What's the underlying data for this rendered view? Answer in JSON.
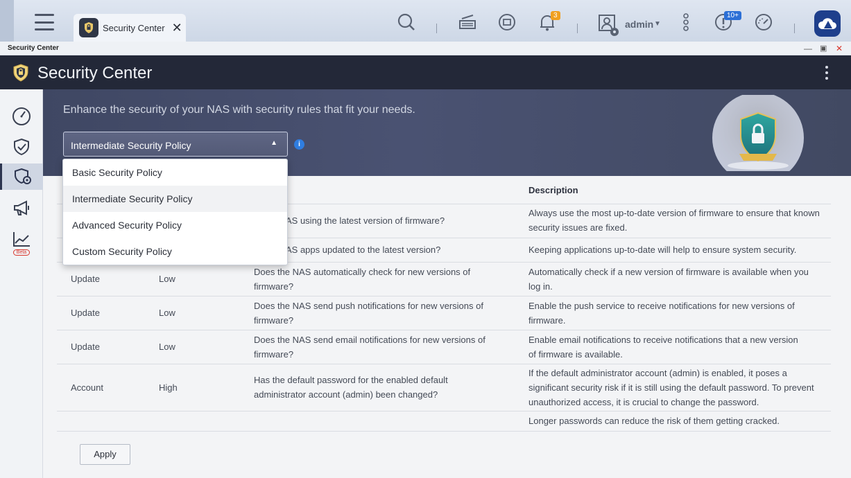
{
  "taskbar": {
    "tab_label": "Security Center",
    "notification_count": "3",
    "user_name": "admin",
    "update_badge": "10+"
  },
  "window": {
    "title": "Security Center"
  },
  "app": {
    "title": "Security Center"
  },
  "banner": {
    "subtitle": "Enhance the security of your NAS with security rules that fit your needs.",
    "info_icon": "i"
  },
  "policy_select": {
    "selected": "Intermediate Security Policy",
    "options": [
      "Basic Security Policy",
      "Intermediate Security Policy",
      "Advanced Security Policy",
      "Custom Security Policy"
    ]
  },
  "table": {
    "description_header": "Description",
    "rows": [
      {
        "category": "",
        "severity": "",
        "check": "AS using the latest version of firmware?",
        "description": "Always use the most up-to-date version of firmware to ensure that known security issues are fixed."
      },
      {
        "category": "",
        "severity": "",
        "check": "AS apps updated to the latest version?",
        "description": "Keeping applications up-to-date will help to ensure system security."
      },
      {
        "category": "Update",
        "severity": "Low",
        "check": "Does the NAS automatically check for new versions of firmware?",
        "description": "Automatically check if a new version of firmware is available when you log in."
      },
      {
        "category": "Update",
        "severity": "Low",
        "check": "Does the NAS send push notifications for new versions of firmware?",
        "description": "Enable the push service to receive notifications for new versions of firmware."
      },
      {
        "category": "Update",
        "severity": "Low",
        "check": "Does the NAS send email notifications for new versions of firmware?",
        "description": "Enable email notifications to receive notifications that a new version of firmware is available."
      },
      {
        "category": "Account",
        "severity": "High",
        "check": "Has the default password for the enabled default administrator account (admin) been changed?",
        "description": "If the default administrator account (admin) is enabled, it poses a significant security risk if it is still using the default password. To prevent unauthorized access, it is crucial to change the password."
      },
      {
        "category": "",
        "severity": "",
        "check": "",
        "description": "Longer passwords can reduce the risk of them getting cracked."
      }
    ]
  },
  "actions": {
    "apply_label": "Apply"
  },
  "sidebar": {
    "beta_label": "Beta"
  },
  "colors": {
    "accent": "#2f7de0",
    "header_bg": "#232838",
    "banner_bg": "#4a5272",
    "badge_orange": "#f0a020"
  }
}
